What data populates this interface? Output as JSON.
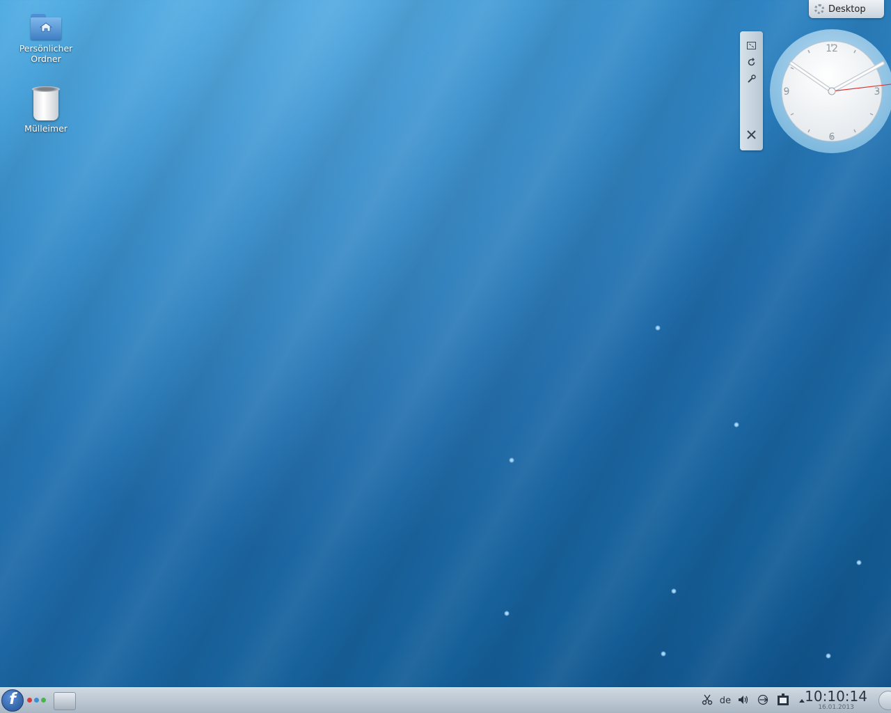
{
  "desktop": {
    "icons": [
      {
        "label_line1": "Persönlicher",
        "label_line2": "Ordner",
        "icon": "home-folder-icon"
      },
      {
        "label": "Mülleimer",
        "icon": "trash-icon"
      }
    ]
  },
  "toolbox": {
    "label": "Desktop",
    "icon": "plasma-cashew-icon"
  },
  "widget_handle": {
    "icons": [
      "resize-icon",
      "rotate-icon",
      "settings-wrench-icon",
      "close-icon"
    ]
  },
  "analog_clock": {
    "numerals": {
      "top": "12",
      "left": "9",
      "right": "3",
      "bottom": "6"
    },
    "time": "10:10:14"
  },
  "panel": {
    "launcher_label": "f",
    "activity_colors": [
      "#d63a3a",
      "#3a8fd6",
      "#48b548"
    ],
    "tray": {
      "keyboard_layout": "de"
    },
    "clock": {
      "time": "10:10:14",
      "date": "16.01.2013"
    }
  },
  "colors": {
    "panel_bg": "#b9c6d2",
    "wallpaper": "#1f6aa8"
  }
}
